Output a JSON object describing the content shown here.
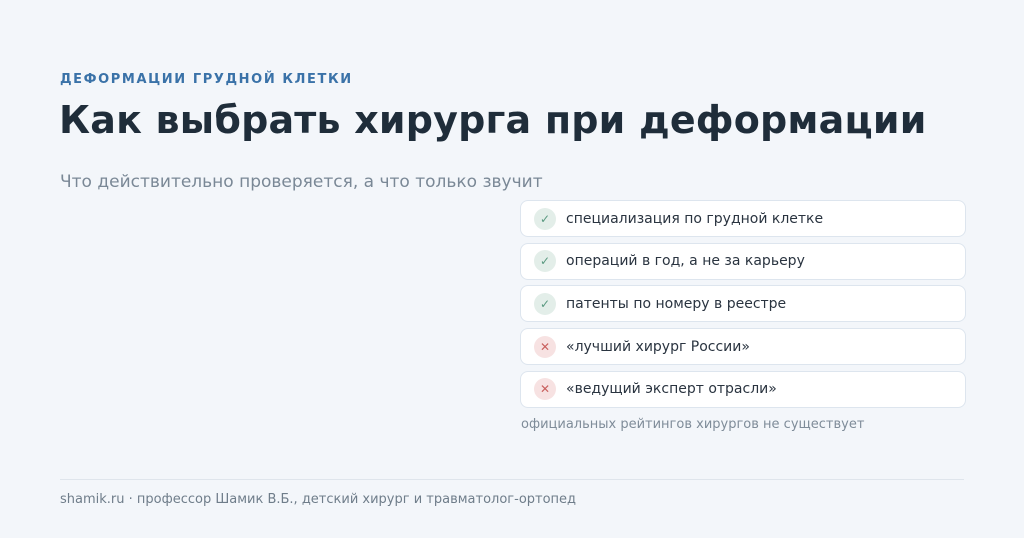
{
  "eyebrow": "ДЕФОРМАЦИИ ГРУДНОЙ КЛЕТКИ",
  "title": "Как выбрать хирурга при деформации",
  "subtitle": "Что действительно проверяется, а что только звучит",
  "checklist": [
    {
      "icon": "check-icon",
      "mark": "✓",
      "status": "verifiable",
      "text": "специализация по грудной клетке"
    },
    {
      "icon": "check-icon",
      "mark": "✓",
      "status": "verifiable",
      "text": "операций в год, а не за карьеру"
    },
    {
      "icon": "check-icon",
      "mark": "✓",
      "status": "verifiable",
      "text": "патенты по номеру в реестре"
    },
    {
      "icon": "cross-icon",
      "mark": "✕",
      "status": "unverifiable",
      "text": "«лучший хирург России»"
    },
    {
      "icon": "cross-icon",
      "mark": "✕",
      "status": "unverifiable",
      "text": "«ведущий эксперт отрасли»"
    }
  ],
  "note": "официальных рейтингов хирургов не существует",
  "footer": "shamik.ru · профессор Шамик В.Б., детский хирург и травматолог-ортопед",
  "colors": {
    "accent": "#3a72a8",
    "ok": "#5a9a80",
    "bad": "#c9605e",
    "background": "#f3f6fa"
  }
}
